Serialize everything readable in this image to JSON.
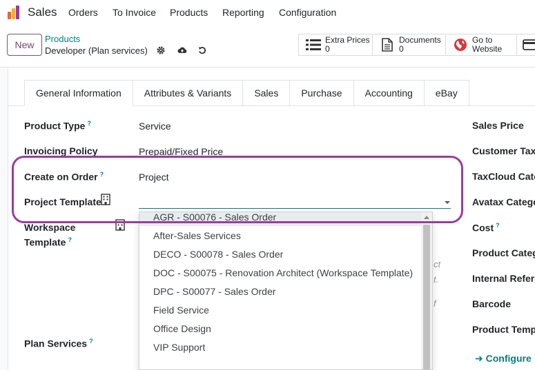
{
  "topnav": {
    "app_name": "Sales",
    "menu": [
      "Orders",
      "To Invoice",
      "Products",
      "Reporting",
      "Configuration"
    ]
  },
  "control": {
    "new_label": "New",
    "breadcrumb_parent": "Products",
    "breadcrumb_current": "Developer (Plan services)",
    "smart_buttons": [
      {
        "label": "Extra Prices",
        "value": "0",
        "icon": "list-icon"
      },
      {
        "label": "Documents",
        "value": "0",
        "icon": "document-icon"
      },
      {
        "label": "Go to",
        "value": "Website",
        "icon": "globe-icon"
      }
    ]
  },
  "tabs": [
    "General Information",
    "Attributes & Variants",
    "Sales",
    "Purchase",
    "Accounting",
    "eBay"
  ],
  "fields": {
    "product_type": {
      "label": "Product Type",
      "value": "Service"
    },
    "invoicing_policy": {
      "label": "Invoicing Policy",
      "value": "Prepaid/Fixed Price"
    },
    "create_on_order": {
      "label": "Create on Order",
      "value": "Project"
    },
    "project_template": {
      "label": "Project Template",
      "value": ""
    },
    "workspace_template": {
      "label_line1": "Workspace",
      "label_line2": "Template"
    },
    "plan_services": {
      "label": "Plan Services"
    }
  },
  "dropdown": {
    "options": [
      "AGR - S00076 - Sales Order",
      "After-Sales Services",
      "DECO - S00078 - Sales Order",
      "DOC - S00075 - Renovation Architect (Workspace Template)",
      "DPC - S00077 - Sales Order",
      "Field Service",
      "Office Design",
      "VIP Support"
    ]
  },
  "ghost_text": [
    "ct",
    "t.",
    "f"
  ],
  "right_fields": [
    "Sales Price",
    "Customer Taxe",
    "TaxCloud Cate",
    "Avatax Catego",
    "Cost",
    "Product Categ",
    "Internal Refere",
    "Barcode",
    "Product Templ"
  ],
  "configure_label": "Configure",
  "colors": {
    "accent": "#714B67",
    "link": "#017e84",
    "highlight": "#9b3b9f"
  }
}
